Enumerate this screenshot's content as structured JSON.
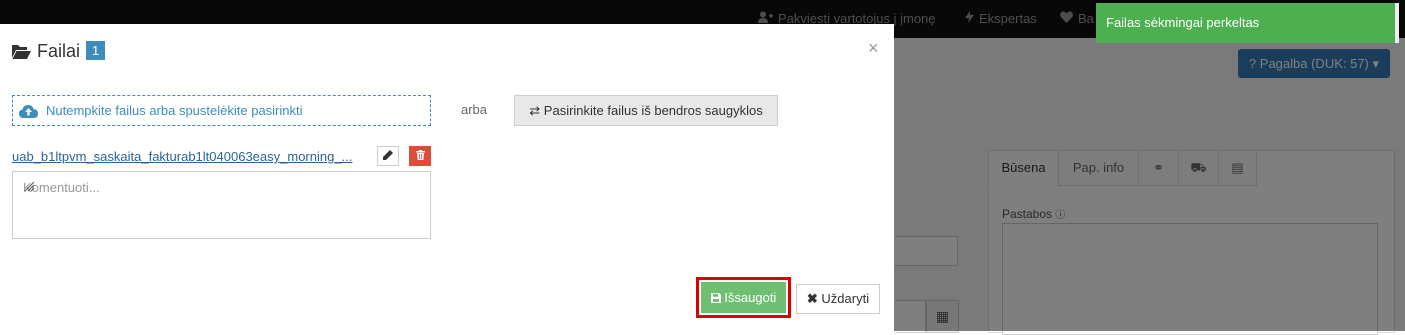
{
  "topbar": {
    "invite": "Pakviesti vartotojus į įmonę",
    "expert": "Ekspertas",
    "partial": "Ba"
  },
  "background": {
    "help_button": "Pagalba (DUK: 57)",
    "tabs": [
      "Būsena",
      "Pap. info"
    ],
    "notes_label": "Pastabos"
  },
  "modal": {
    "title": "Failai",
    "badge": "1",
    "close": "×",
    "dropzone_label": "Nutempkite failus arba spustelėkite pasirinkti",
    "or_label": "arba",
    "storage_button": "Pasirinkite failus iš bendros saugyklos",
    "file_name": "uab_b1ltpvm_saskaita_fakturab1lt040063easy_morning_...",
    "comment_placeholder": "Komentuoti...",
    "save_button": "Išsaugoti",
    "close_button": "Uždaryti"
  },
  "toast": {
    "message": "Failas sėkmingai perkeltas"
  },
  "colors": {
    "primary": "#3c8dbc",
    "success": "#6fbf73",
    "danger": "#dd4b39",
    "highlight": "#dd0000",
    "toast": "#4caf50"
  }
}
